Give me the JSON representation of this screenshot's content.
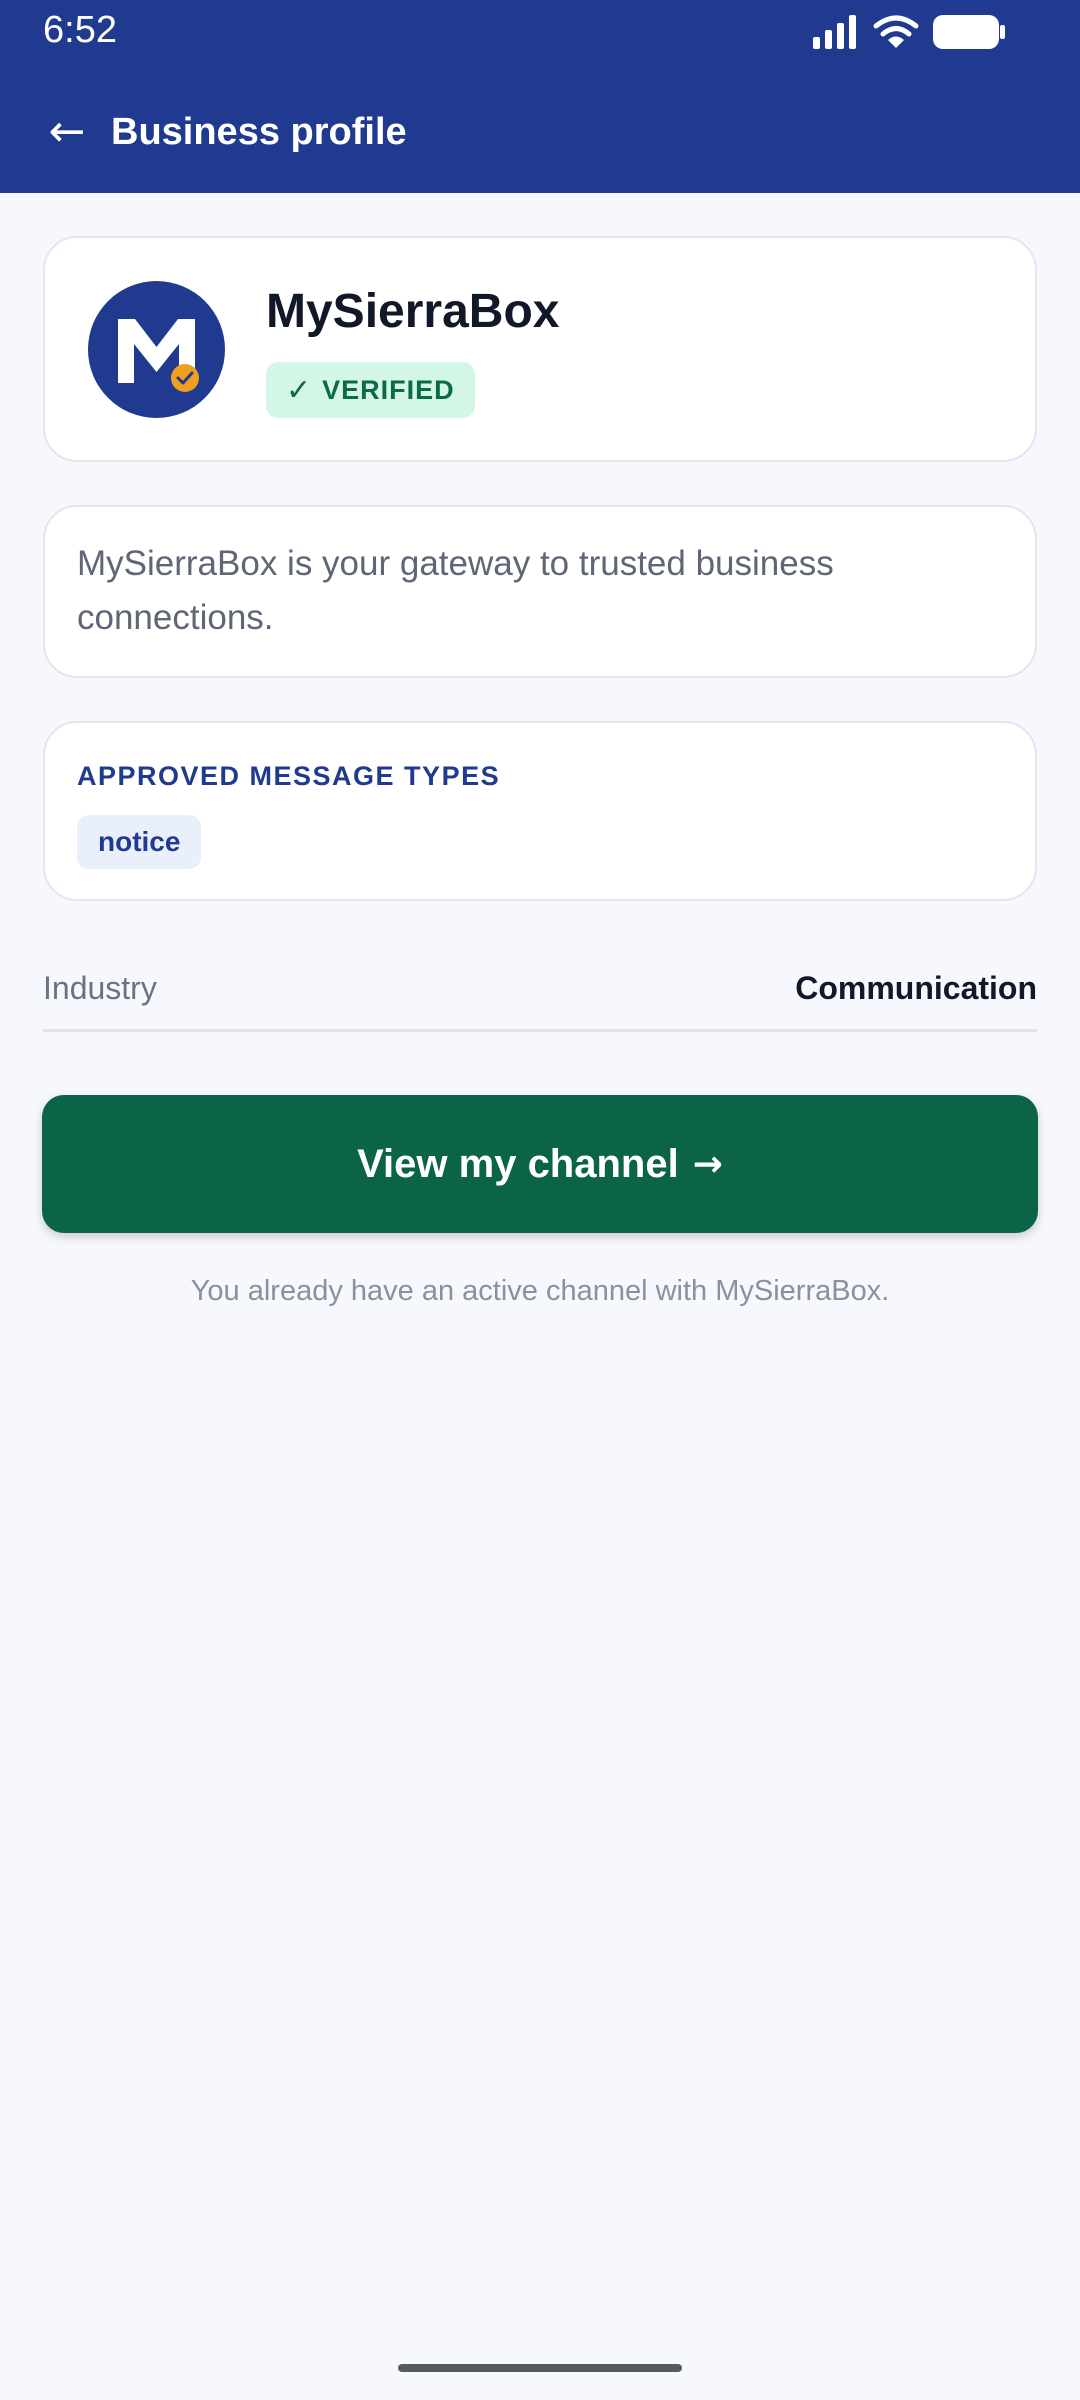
{
  "status_bar": {
    "time": "6:52",
    "icons": [
      "signal-icon",
      "wifi-icon",
      "battery-icon"
    ]
  },
  "app_bar": {
    "back_icon": "back-arrow-icon",
    "back_glyph": "←",
    "title": "Business profile"
  },
  "business": {
    "logo_letter": "M",
    "name": "MySierraBox",
    "verified_glyph": "✓",
    "verified_label": "VERIFIED",
    "description": "MySierraBox is your gateway to trusted business connections."
  },
  "message_types": {
    "heading": "APPROVED MESSAGE TYPES",
    "items": [
      "notice"
    ]
  },
  "details": {
    "industry_label": "Industry",
    "industry_value": "Communication"
  },
  "cta": {
    "label": "View my channel",
    "arrow": "→"
  },
  "note": "You already have an active channel with MySierraBox.",
  "colors": {
    "brand_blue": "#1f3a8f",
    "cta_green": "#0b6446",
    "verified_bg": "#d4f6e6",
    "verified_text": "#0b6b43",
    "accent_orange": "#f0a01e",
    "background": "#f7f8fd"
  }
}
